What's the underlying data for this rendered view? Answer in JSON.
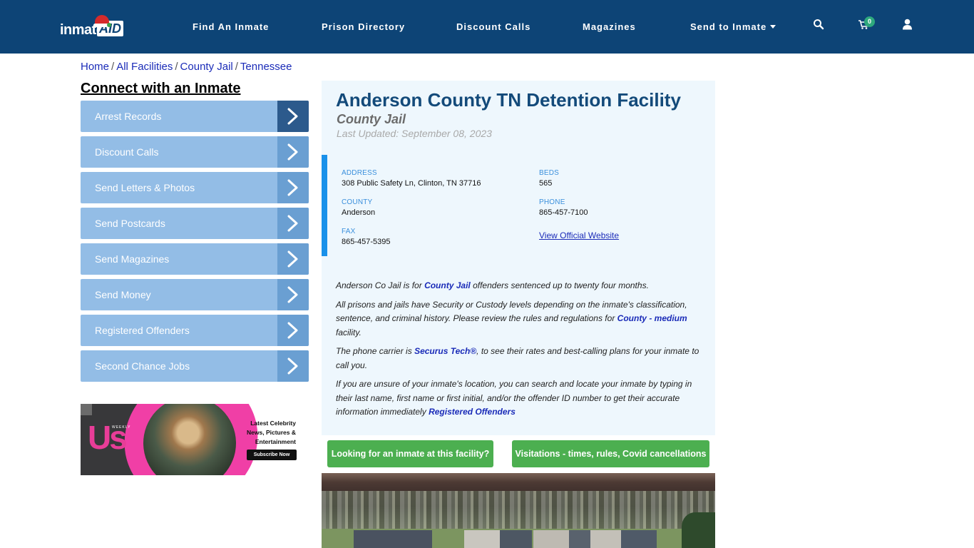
{
  "header": {
    "logo_text": "inmate",
    "logo_accent": "AID",
    "nav": [
      {
        "label": "Find An Inmate"
      },
      {
        "label": "Prison Directory"
      },
      {
        "label": "Discount Calls"
      },
      {
        "label": "Magazines"
      },
      {
        "label": "Send to Inmate",
        "has_dropdown": true
      }
    ],
    "icons": {
      "search": "search-icon",
      "cart": "cart-icon",
      "user": "user-icon"
    },
    "cart_count": "0",
    "colors": {
      "background": "#0d4476",
      "badge": "#2ea97d"
    }
  },
  "breadcrumb": [
    {
      "label": "Home"
    },
    {
      "label": "All Facilities"
    },
    {
      "label": "County Jail"
    },
    {
      "label": "Tennessee"
    }
  ],
  "breadcrumb_separator": "/",
  "sidebar": {
    "title": "Connect with an Inmate",
    "items": [
      {
        "label": "Arrest Records",
        "active": true
      },
      {
        "label": "Discount Calls"
      },
      {
        "label": "Send Letters & Photos"
      },
      {
        "label": "Send Postcards"
      },
      {
        "label": "Send Magazines"
      },
      {
        "label": "Send Money"
      },
      {
        "label": "Registered Offenders"
      },
      {
        "label": "Second Chance Jobs"
      }
    ],
    "colors": {
      "item": "#93bde6",
      "chevron": "#6a9fd2",
      "chevron_active": "#2c5a8c"
    }
  },
  "ad": {
    "brand": "Us",
    "brand_sub": "WEEKLY",
    "headline": "Latest Celebrity News, Pictures & Entertainment",
    "cta": "Subscribe Now"
  },
  "facility": {
    "name": "Anderson County TN Detention Facility",
    "type": "County Jail",
    "last_updated": "Last Updated: September 08, 2023",
    "fields": {
      "address_label": "ADDRESS",
      "address": "308 Public Safety Ln, Clinton, TN 37716",
      "county_label": "COUNTY",
      "county": "Anderson",
      "fax_label": "FAX",
      "fax": "865-457-5395",
      "beds_label": "BEDS",
      "beds": "565",
      "phone_label": "PHONE",
      "phone": "865-457-7100",
      "website_link": "View Official Website"
    },
    "description": {
      "p1_a": "Anderson Co Jail is for ",
      "p1_link": "County Jail",
      "p1_b": " offenders sentenced up to twenty four months.",
      "p2_a": "All prisons and jails have Security or Custody levels depending on the inmate's classification, sentence, and criminal history. Please review the rules and regulations for ",
      "p2_link": "County - medium",
      "p2_b": " facility.",
      "p3_a": "The phone carrier is ",
      "p3_link": "Securus Tech®",
      "p3_b": ", to see their rates and best-calling plans for your inmate to call you.",
      "p4_a": "If you are unsure of your inmate's location, you can search and locate your inmate by typing in their last name, first name or first initial, and/or the offender ID number to get their accurate information immediately ",
      "p4_link": "Registered Offenders"
    },
    "buttons": {
      "find_inmate": "Looking for an inmate at this facility?",
      "visitations": "Visitations - times, rules, Covid cancellations"
    },
    "colors": {
      "title": "#134a7a",
      "panel_bg": "#eef7fd",
      "accent_bar": "#1991ea",
      "button": "#4caf50",
      "link": "#1a2bb8"
    }
  },
  "facility_photo": {
    "alt": "Aerial view of facility"
  }
}
